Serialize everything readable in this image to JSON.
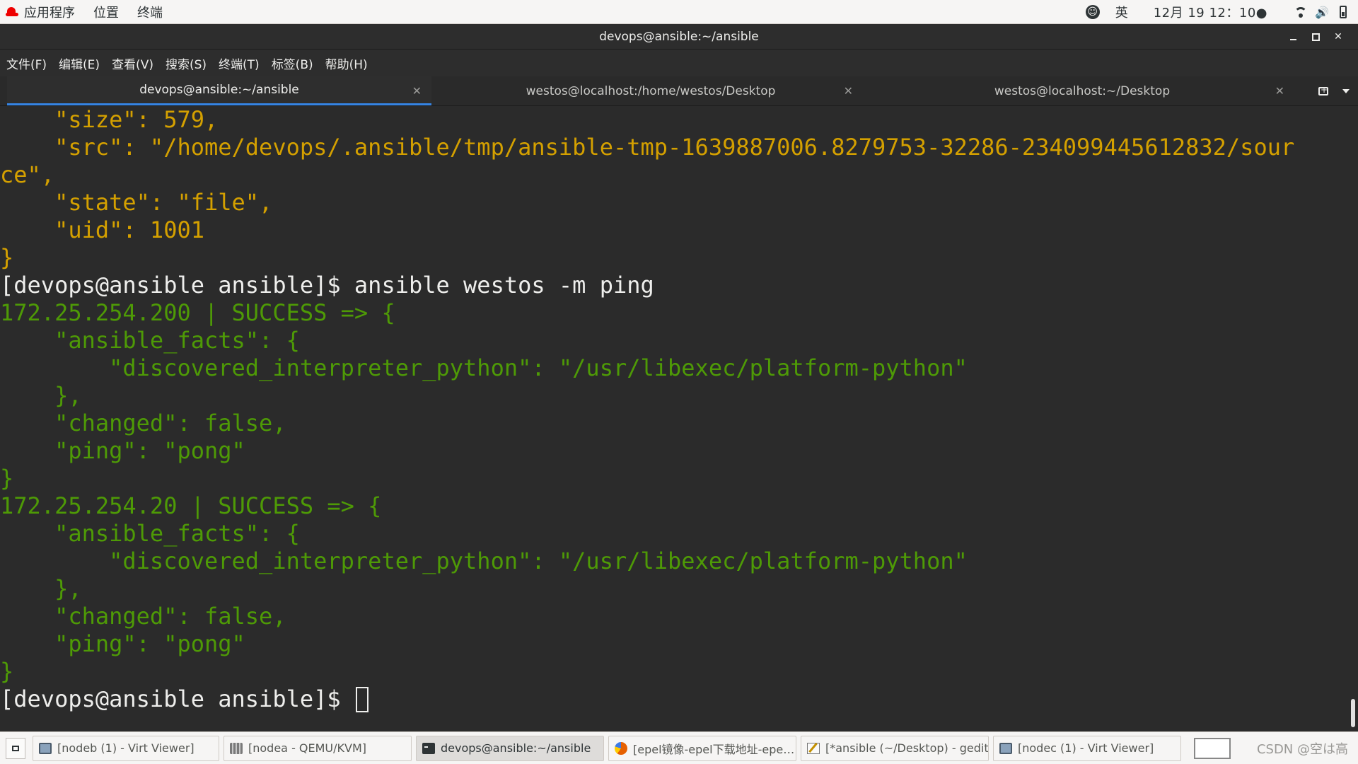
{
  "topbar": {
    "apps_label": "应用程序",
    "places_label": "位置",
    "terminal_label": "终端",
    "lang": "英",
    "clock": "12月 19  12：10●"
  },
  "window": {
    "title": "devops@ansible:~/ansible"
  },
  "menubar": {
    "items": [
      "文件(F)",
      "编辑(E)",
      "查看(V)",
      "搜索(S)",
      "终端(T)",
      "标签(B)",
      "帮助(H)"
    ]
  },
  "tabs": [
    {
      "label": "devops@ansible:~/ansible",
      "active": true
    },
    {
      "label": "westos@localhost:/home/westos/Desktop",
      "active": false
    },
    {
      "label": "westos@localhost:~/Desktop",
      "active": false
    }
  ],
  "terminal": {
    "lines": [
      {
        "text": "    \"size\": 579,",
        "color": "yellow"
      },
      {
        "text": "    \"src\": \"/home/devops/.ansible/tmp/ansible-tmp-1639887006.8279753-32286-234099445612832/sour",
        "color": "yellow"
      },
      {
        "text": "ce\",",
        "color": "yellow"
      },
      {
        "text": "    \"state\": \"file\",",
        "color": "yellow"
      },
      {
        "text": "    \"uid\": 1001",
        "color": "yellow"
      },
      {
        "text": "}",
        "color": "yellow"
      },
      {
        "text": "[devops@ansible ansible]$ ansible westos -m ping",
        "color": "white"
      },
      {
        "text": "172.25.254.200 | SUCCESS => {",
        "color": "green"
      },
      {
        "text": "    \"ansible_facts\": {",
        "color": "green"
      },
      {
        "text": "        \"discovered_interpreter_python\": \"/usr/libexec/platform-python\"",
        "color": "green"
      },
      {
        "text": "    },",
        "color": "green"
      },
      {
        "text": "    \"changed\": false,",
        "color": "green"
      },
      {
        "text": "    \"ping\": \"pong\"",
        "color": "green"
      },
      {
        "text": "}",
        "color": "green"
      },
      {
        "text": "172.25.254.20 | SUCCESS => {",
        "color": "green"
      },
      {
        "text": "    \"ansible_facts\": {",
        "color": "green"
      },
      {
        "text": "        \"discovered_interpreter_python\": \"/usr/libexec/platform-python\"",
        "color": "green"
      },
      {
        "text": "    },",
        "color": "green"
      },
      {
        "text": "    \"changed\": false,",
        "color": "green"
      },
      {
        "text": "    \"ping\": \"pong\"",
        "color": "green"
      },
      {
        "text": "}",
        "color": "green"
      }
    ],
    "prompt": "[devops@ansible ansible]$ "
  },
  "colors": {
    "yellow": "#d4a000",
    "green": "#4e9a06",
    "white": "#eeeeec",
    "accent": "#3584e4"
  },
  "taskbar": {
    "tasks": [
      {
        "label": "[nodeb (1) - Virt Viewer]",
        "icon": "monitor-icon",
        "active": false
      },
      {
        "label": "[nodea - QEMU/KVM]",
        "icon": "qemu-icon",
        "active": false
      },
      {
        "label": "devops@ansible:~/ansible",
        "icon": "terminal-icon",
        "active": true
      },
      {
        "label": "[epel镜像-epel下载地址-epe…",
        "icon": "firefox-icon",
        "active": false
      },
      {
        "label": "[*ansible (~/Desktop) - gedit]",
        "icon": "gedit-icon",
        "active": false
      },
      {
        "label": "[nodec (1) - Virt Viewer]",
        "icon": "monitor-icon",
        "active": false
      }
    ],
    "watermark": "CSDN @空は高"
  }
}
